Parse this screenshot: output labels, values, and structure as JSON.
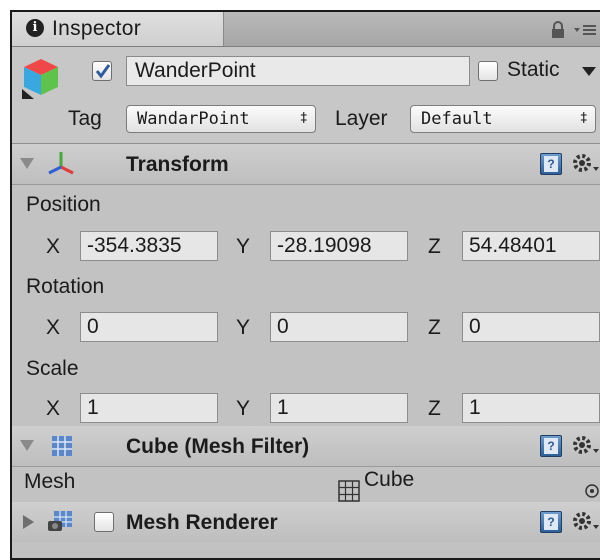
{
  "tab": {
    "label": "Inspector",
    "info_glyph": "i"
  },
  "header": {
    "name": "WanderPoint",
    "static_label": "Static",
    "tag_label": "Tag",
    "tag_value": "WandarPoint",
    "layer_label": "Layer",
    "layer_value": "Default",
    "popup_arrows": "‡"
  },
  "transform": {
    "title": "Transform",
    "position": {
      "label": "Position",
      "x": "-354.3835",
      "y": "-28.19098",
      "z": "54.48401"
    },
    "rotation": {
      "label": "Rotation",
      "x": "0",
      "y": "0",
      "z": "0"
    },
    "scale": {
      "label": "Scale",
      "x": "1",
      "y": "1",
      "z": "1"
    },
    "axis_x": "X",
    "axis_y": "Y",
    "axis_z": "Z"
  },
  "mesh_filter": {
    "title": "Cube (Mesh Filter)",
    "mesh_label": "Mesh",
    "mesh_value": "Cube"
  },
  "mesh_renderer": {
    "title": "Mesh Renderer"
  },
  "help_glyph": "?",
  "icons": [
    "info-icon",
    "lock-icon",
    "tab-menu-icon",
    "gameobject-icon",
    "transform-icon",
    "mesh-filter-icon",
    "mesh-renderer-icon",
    "help-icon",
    "gear-icon",
    "object-picker-icon"
  ],
  "colors": {
    "panel": "#c2c2c2",
    "checkmark": "#2f5c9e",
    "field": "#e6e6e6"
  }
}
